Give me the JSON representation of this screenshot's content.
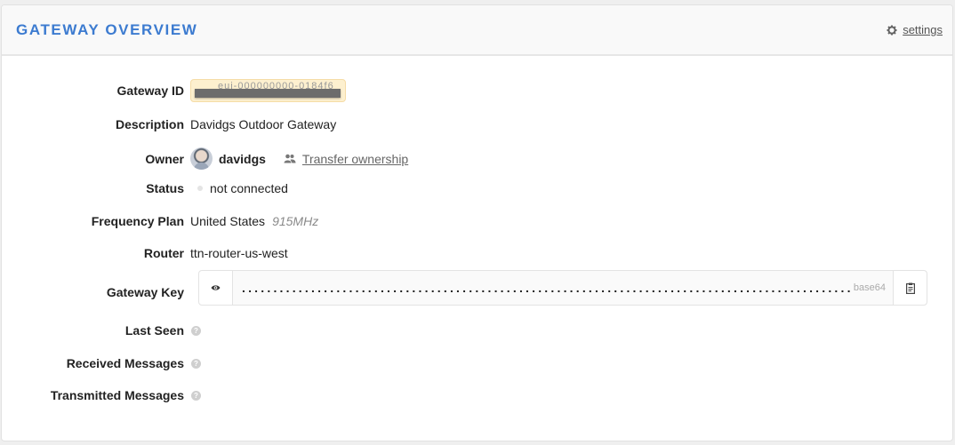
{
  "header": {
    "title": "GATEWAY OVERVIEW",
    "settings_label": "settings",
    "settings_icon": "gear-icon"
  },
  "fields": {
    "gateway_id": {
      "label": "Gateway ID",
      "value_visible_fragment": "eui-000000000-0184f6",
      "redacted": true
    },
    "description": {
      "label": "Description",
      "value": "Davidgs Outdoor Gateway"
    },
    "owner": {
      "label": "Owner",
      "username": "davidgs",
      "transfer_label": "Transfer ownership",
      "transfer_icon": "users-icon"
    },
    "status": {
      "label": "Status",
      "value": "not connected",
      "dot_color": "#e4e4e4"
    },
    "frequency_plan": {
      "label": "Frequency Plan",
      "region": "United States",
      "band": "915MHz"
    },
    "router": {
      "label": "Router",
      "value": "ttn-router-us-west"
    },
    "gateway_key": {
      "label": "Gateway Key",
      "masked_value": "••••••••••••••••••••••••••••••••••••••••••••••••••••••••••••••••••••••••••••••••••••••••••••••••••••••••••••••••••••••••••••••",
      "encoding": "base64",
      "reveal_icon": "eye-icon",
      "copy_icon": "clipboard-icon"
    },
    "last_seen": {
      "label": "Last Seen",
      "help": "?"
    },
    "received_messages": {
      "label": "Received Messages",
      "help": "?"
    },
    "transmitted_messages": {
      "label": "Transmitted Messages",
      "help": "?"
    }
  },
  "colors": {
    "title_blue": "#3c7bd0",
    "id_highlight": "#fdf0cf"
  }
}
